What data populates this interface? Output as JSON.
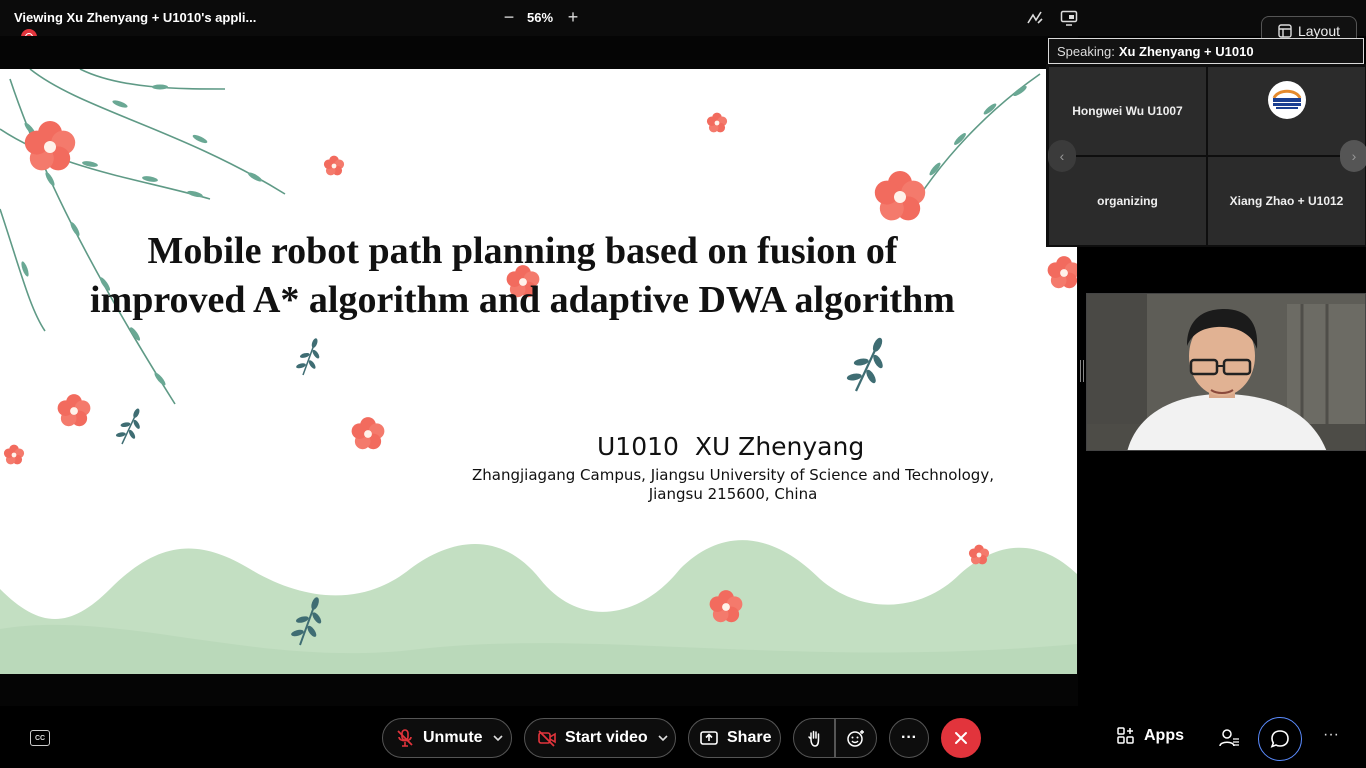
{
  "topbar": {
    "viewing_title": "Viewing Xu Zhenyang + U1010's appli...",
    "zoom_minus": "−",
    "zoom_level": "56%",
    "zoom_plus": "+",
    "layout_label": "Layout"
  },
  "slide": {
    "title_line1": "Mobile robot path planning based on fusion of",
    "title_line2": "improved A* algorithm and adaptive DWA algorithm",
    "author": "U1010  XU Zhenyang",
    "affiliation_line1": "Zhangjiagang Campus, Jiangsu University of Science and Technology,",
    "affiliation_line2": "Jiangsu 215600, China"
  },
  "panel": {
    "speaking_label": "Speaking:",
    "speaking_name": "Xu Zhenyang + U1010",
    "tiles": [
      {
        "name": "Hongwei Wu U1007"
      },
      {
        "name": ""
      },
      {
        "name": "organizing"
      },
      {
        "name": "Xiang Zhao + U1012"
      }
    ],
    "prev": "‹",
    "next": "›"
  },
  "toolbar": {
    "cc_label": "CC",
    "unmute_label": "Unmute",
    "video_label": "Start video",
    "share_label": "Share",
    "more_label": "···",
    "apps_label": "Apps",
    "overflow_label": "···"
  },
  "colors": {
    "accent_blue": "#5b8cff",
    "leave_red": "#e2343c",
    "recording_red": "#e2343c",
    "slide_hills": "#c3dfc2",
    "flower_coral": "#f26b5e",
    "leaf_green": "#5a9a84"
  },
  "icons": {
    "rec": "recording-indicator-icon",
    "annotate": "annotate-icon",
    "share_screen": "share-screen-icon",
    "layout": "layout-grid-icon",
    "mic": "microphone-muted-icon",
    "video": "video-off-icon",
    "share": "share-upload-icon",
    "hand": "raise-hand-icon",
    "reactions": "smiley-reactions-icon",
    "leave": "close-x-icon",
    "apps": "apps-grid-icon",
    "participants": "participants-icon",
    "chat": "chat-bubble-icon"
  }
}
